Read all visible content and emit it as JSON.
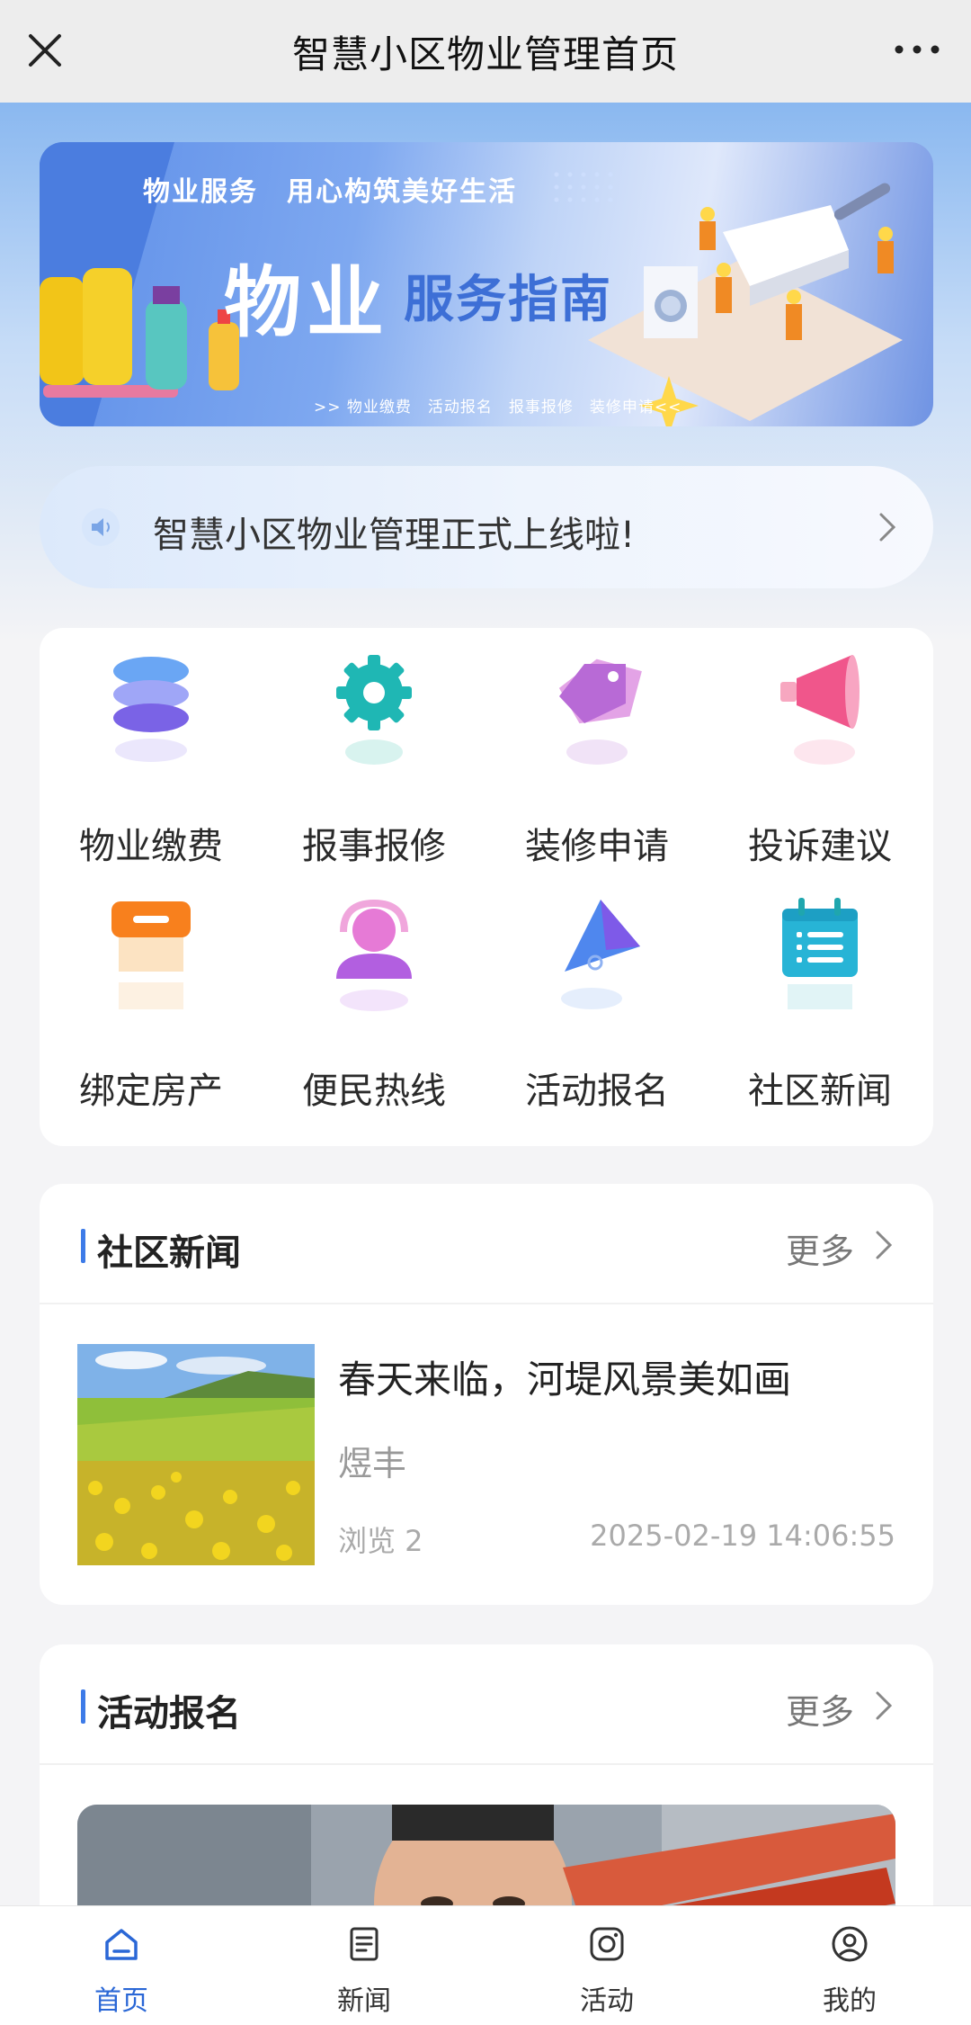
{
  "header": {
    "title": "智慧小区物业管理首页"
  },
  "banner": {
    "tagline": "物业服务　用心构筑美好生活",
    "headline": "物业",
    "subheadline": "服务指南",
    "links": ">> 物业缴费　活动报名　报事报修　装修申请<<"
  },
  "notice": {
    "text": "智慧小区物业管理正式上线啦!"
  },
  "services": [
    {
      "label": "物业缴费",
      "icon": "database-icon"
    },
    {
      "label": "报事报修",
      "icon": "gear-icon"
    },
    {
      "label": "装修申请",
      "icon": "tag-icon"
    },
    {
      "label": "投诉建议",
      "icon": "megaphone-icon"
    },
    {
      "label": "绑定房产",
      "icon": "shop-icon"
    },
    {
      "label": "便民热线",
      "icon": "headset-icon"
    },
    {
      "label": "活动报名",
      "icon": "flag-icon"
    },
    {
      "label": "社区新闻",
      "icon": "calendar-icon"
    }
  ],
  "news_section": {
    "title": "社区新闻",
    "more": "更多",
    "item": {
      "title": "春天来临，河堤风景美如画",
      "author": "煜丰",
      "views": "浏览 2",
      "date": "2025-02-19 14:06:55"
    }
  },
  "activity_section": {
    "title": "活动报名",
    "more": "更多"
  },
  "bottom_nav": [
    {
      "label": "首页",
      "active": true,
      "icon": "home-icon"
    },
    {
      "label": "新闻",
      "active": false,
      "icon": "document-icon"
    },
    {
      "label": "活动",
      "active": false,
      "icon": "camera-icon"
    },
    {
      "label": "我的",
      "active": false,
      "icon": "user-icon"
    }
  ],
  "colors": {
    "accent": "#2a67d6",
    "section_bar": "#3d7be8"
  }
}
